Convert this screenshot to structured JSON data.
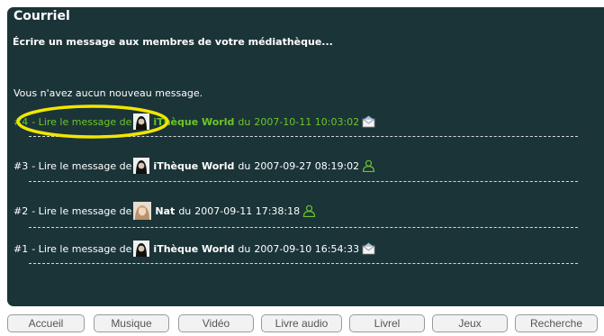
{
  "panel": {
    "title": "Courriel",
    "subtitle": "Écrire un message aux membres de votre médiathèque...",
    "notice": "Vous n'avez aucun nouveau message."
  },
  "messages": [
    {
      "number": "#4",
      "link_text": "- Lire le message de",
      "author": "iThèque World",
      "date_prefix": "du",
      "date": "2007-10-11 10:03:02",
      "avatar": "ithèque-world-avatar",
      "status_icon": "envelope-icon",
      "highlighted": true
    },
    {
      "number": "#3",
      "link_text": "- Lire le message de",
      "author": "iThèque World",
      "date_prefix": "du",
      "date": "2007-09-27 08:19:02",
      "avatar": "ithèque-world-avatar",
      "status_icon": "user-icon",
      "highlighted": false
    },
    {
      "number": "#2",
      "link_text": "- Lire le message de",
      "author": "Nat",
      "date_prefix": "du",
      "date": "2007-09-11 17:38:18",
      "avatar": "nat-avatar",
      "status_icon": "user-icon",
      "highlighted": false
    },
    {
      "number": "#1",
      "link_text": "- Lire le message de",
      "author": "iThèque World",
      "date_prefix": "du",
      "date": "2007-09-10 16:54:33",
      "avatar": "ithèque-world-avatar",
      "status_icon": "envelope-icon",
      "highlighted": false
    }
  ],
  "nav": [
    {
      "label": "Accueil"
    },
    {
      "label": "Musique"
    },
    {
      "label": "Vidéo"
    },
    {
      "label": "Livre audio"
    },
    {
      "label": "Livrel"
    },
    {
      "label": "Jeux"
    },
    {
      "label": "Recherche"
    }
  ],
  "colors": {
    "panel_background": "#1b3438",
    "highlight_text": "#6cc52a",
    "annotation_ellipse": "#f2e600",
    "status_user": "#6cc52a"
  }
}
